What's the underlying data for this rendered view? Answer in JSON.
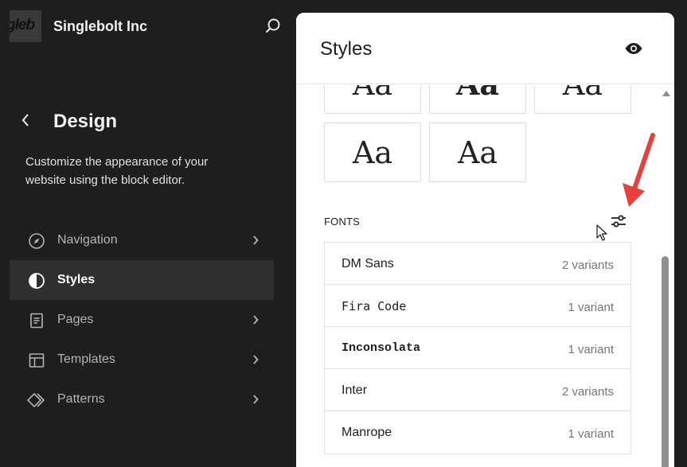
{
  "site": {
    "title": "Singlebolt Inc",
    "logo_text": "gleb"
  },
  "sidebar": {
    "heading": "Design",
    "description": "Customize the appearance of your website using the block editor.",
    "items": [
      {
        "label": "Navigation",
        "icon": "compass-icon",
        "active": false
      },
      {
        "label": "Styles",
        "icon": "half-circle-icon",
        "active": true
      },
      {
        "label": "Pages",
        "icon": "page-icon",
        "active": false
      },
      {
        "label": "Templates",
        "icon": "layout-icon",
        "active": false
      },
      {
        "label": "Patterns",
        "icon": "diamond-icon",
        "active": false
      }
    ]
  },
  "panel": {
    "title": "Styles",
    "typography_tiles": [
      "Aa",
      "Aa",
      "Aa",
      "Aa",
      "Aa"
    ],
    "fonts_label": "FONTS",
    "fonts": [
      {
        "name": "DM Sans",
        "variants": "2 variants"
      },
      {
        "name": "Fira Code",
        "variants": "1 variant"
      },
      {
        "name": "Inconsolata",
        "variants": "1 variant"
      },
      {
        "name": "Inter",
        "variants": "2 variants"
      },
      {
        "name": "Manrope",
        "variants": "1 variant"
      }
    ]
  },
  "colors": {
    "sidebar_bg": "#1e1e1e",
    "active_item_bg": "#2f2f2f",
    "annotation_arrow": "#e8413c"
  }
}
